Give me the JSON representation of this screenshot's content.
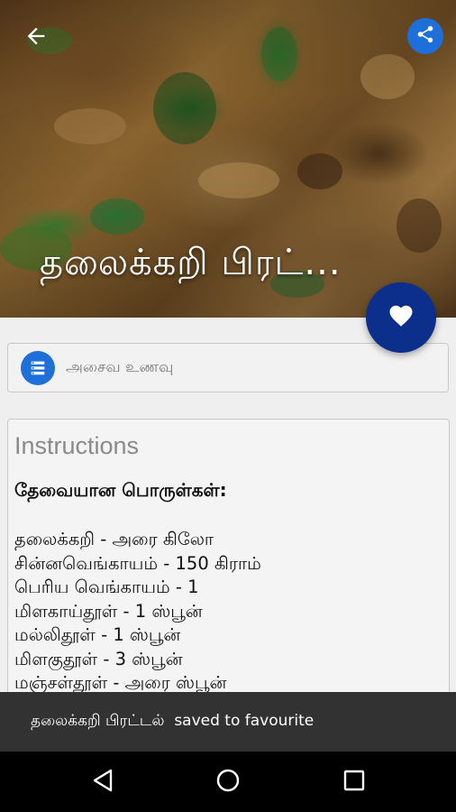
{
  "header": {
    "recipe_title": "தலைக்கறி பிரட்...",
    "back_icon": "arrow-back-icon",
    "share_icon": "share-icon",
    "share_color": "#1e6fd9"
  },
  "favourite": {
    "icon": "heart-icon",
    "color": "#0d2f8c"
  },
  "category": {
    "icon": "list-icon",
    "label": "அசைவ உணவு"
  },
  "instructions": {
    "heading": "Instructions",
    "ingredients_title": "தேவையான பொருள்கள்:",
    "ingredients": [
      "தலைக்கறி - அரை கிலோ",
      "சின்னவெங்காயம் - 150 கிராம்",
      "பெரிய வெங்காயம் - 1",
      "மிளகாய்தூள் - 1 ஸ்பூன்",
      "மல்லிதூள் - 1 ஸ்பூன்",
      "மிளகுதூள் - 3 ஸ்பூன்",
      "மஞ்சள்தூள் - அரை ஸ்பூன்"
    ]
  },
  "snackbar": {
    "message": "தலைக்கறி பிரட்டல்  saved to favourite"
  },
  "navigation": {
    "back_icon": "nav-back-triangle-icon",
    "home_icon": "nav-home-circle-icon",
    "recents_icon": "nav-recents-square-icon"
  }
}
